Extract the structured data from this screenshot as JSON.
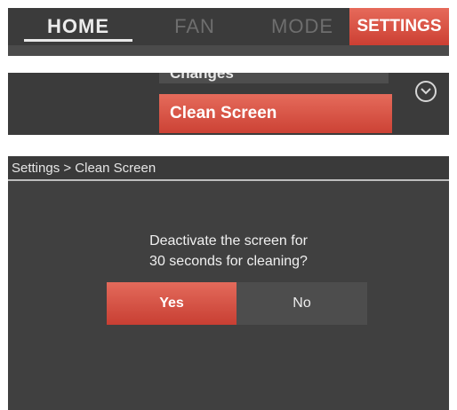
{
  "tabs": {
    "home": "HOME",
    "fan": "FAN",
    "mode": "MODE",
    "settings": "SETTINGS",
    "active": "HOME",
    "selected": "SETTINGS"
  },
  "menu": {
    "previous_item": "Changes",
    "selected_item": "Clean Screen",
    "scroll_icon": "chevron-down-circle-icon"
  },
  "dialog": {
    "breadcrumb": "Settings > Clean Screen",
    "prompt_line1": "Deactivate the screen for",
    "prompt_line2": "30 seconds for cleaning?",
    "yes_label": "Yes",
    "no_label": "No"
  },
  "colors": {
    "accent": "#d94f41",
    "panel_bg": "#3a3a3a",
    "text_light": "#eeeeee",
    "text_dim": "#6e6e6e"
  }
}
